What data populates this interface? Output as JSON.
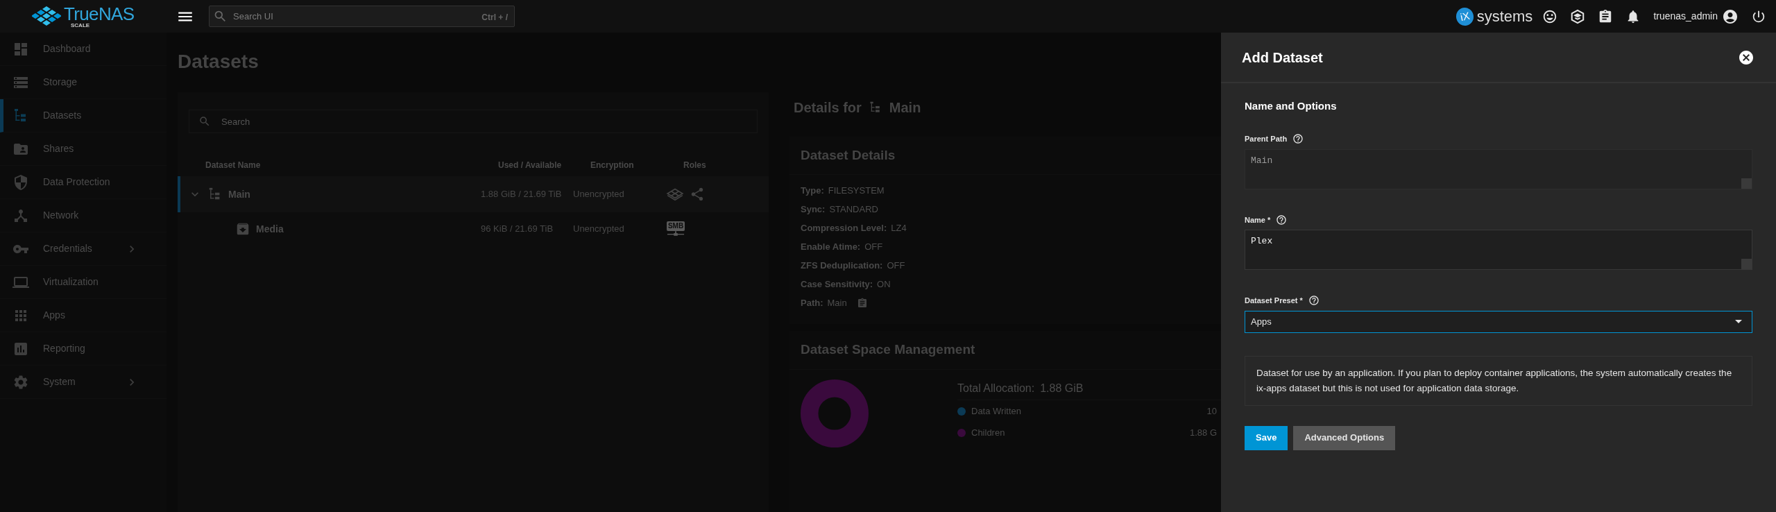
{
  "topbar": {
    "logo": {
      "name": "TrueNAS",
      "edition": "SCALE"
    },
    "search": {
      "placeholder": "Search UI",
      "shortcut": "Ctrl + /"
    },
    "vendor_logo": {
      "mark": "iX",
      "text": "systems"
    },
    "username": "truenas_admin"
  },
  "sidebar": {
    "items": [
      {
        "label": "Dashboard",
        "selected": false,
        "expandable": false
      },
      {
        "label": "Storage",
        "selected": false,
        "expandable": false
      },
      {
        "label": "Datasets",
        "selected": true,
        "expandable": false
      },
      {
        "label": "Shares",
        "selected": false,
        "expandable": false
      },
      {
        "label": "Data Protection",
        "selected": false,
        "expandable": false
      },
      {
        "label": "Network",
        "selected": false,
        "expandable": false
      },
      {
        "label": "Credentials",
        "selected": false,
        "expandable": true
      },
      {
        "label": "Virtualization",
        "selected": false,
        "expandable": false
      },
      {
        "label": "Apps",
        "selected": false,
        "expandable": false
      },
      {
        "label": "Reporting",
        "selected": false,
        "expandable": false
      },
      {
        "label": "System",
        "selected": false,
        "expandable": true
      }
    ]
  },
  "page": {
    "title": "Datasets"
  },
  "datasets_table": {
    "search": {
      "placeholder": "Search"
    },
    "columns": [
      "Dataset Name",
      "Used / Available",
      "Encryption",
      "Roles"
    ],
    "rows": [
      {
        "name": "Main",
        "kind": "pool",
        "used_available": "1.88 GiB / 21.69 TiB",
        "encryption": "Unencrypted",
        "selected": true,
        "expanded": true,
        "roles": [
          {
            "kind": "apps"
          },
          {
            "kind": "share"
          }
        ],
        "children": [
          {
            "name": "Media",
            "kind": "dataset",
            "used_available": "96 KiB / 21.69 TiB",
            "encryption": "Unencrypted",
            "selected": false,
            "roles": [
              {
                "kind": "smb",
                "label": "SMB"
              }
            ]
          }
        ]
      }
    ]
  },
  "details": {
    "title": "Details for",
    "dataset": "Main",
    "dataset_details": {
      "title": "Dataset Details",
      "fields": [
        {
          "label": "Type:",
          "value": "FILESYSTEM",
          "copyable": false
        },
        {
          "label": "Sync:",
          "value": "STANDARD",
          "copyable": false
        },
        {
          "label": "Compression Level:",
          "value": "LZ4",
          "copyable": false
        },
        {
          "label": "Enable Atime:",
          "value": "OFF",
          "copyable": false
        },
        {
          "label": "ZFS Deduplication:",
          "value": "OFF",
          "copyable": false
        },
        {
          "label": "Case Sensitivity:",
          "value": "ON",
          "copyable": false
        },
        {
          "label": "Path:",
          "value": "Main",
          "copyable": true
        }
      ]
    },
    "space_management": {
      "title": "Dataset Space Management",
      "total_label": "Total Allocation:",
      "total_value": "1.88 GiB",
      "legend": [
        {
          "label": "Data Written",
          "value": "10",
          "color": "#0b3a55"
        },
        {
          "label": "Children",
          "value": "1.88 G",
          "color": "#3a0a3d"
        }
      ]
    }
  },
  "add_dataset": {
    "title": "Add Dataset",
    "section": "Name and Options",
    "fields": [
      {
        "kind": "textarea",
        "label": "Parent Path",
        "value": "Main",
        "disabled": true
      },
      {
        "kind": "textarea",
        "label": "Name *",
        "value": "Plex",
        "disabled": false
      },
      {
        "kind": "select",
        "label": "Dataset Preset *",
        "value": "Apps",
        "focused": true
      }
    ],
    "description": "Dataset for use by an application. If you plan to deploy container applications, the system automatically creates the ix-apps dataset but this is not used for application data storage.",
    "buttons": [
      {
        "label": "Save",
        "kind": "primary"
      },
      {
        "label": "Advanced Options",
        "kind": "secondary"
      }
    ]
  }
}
